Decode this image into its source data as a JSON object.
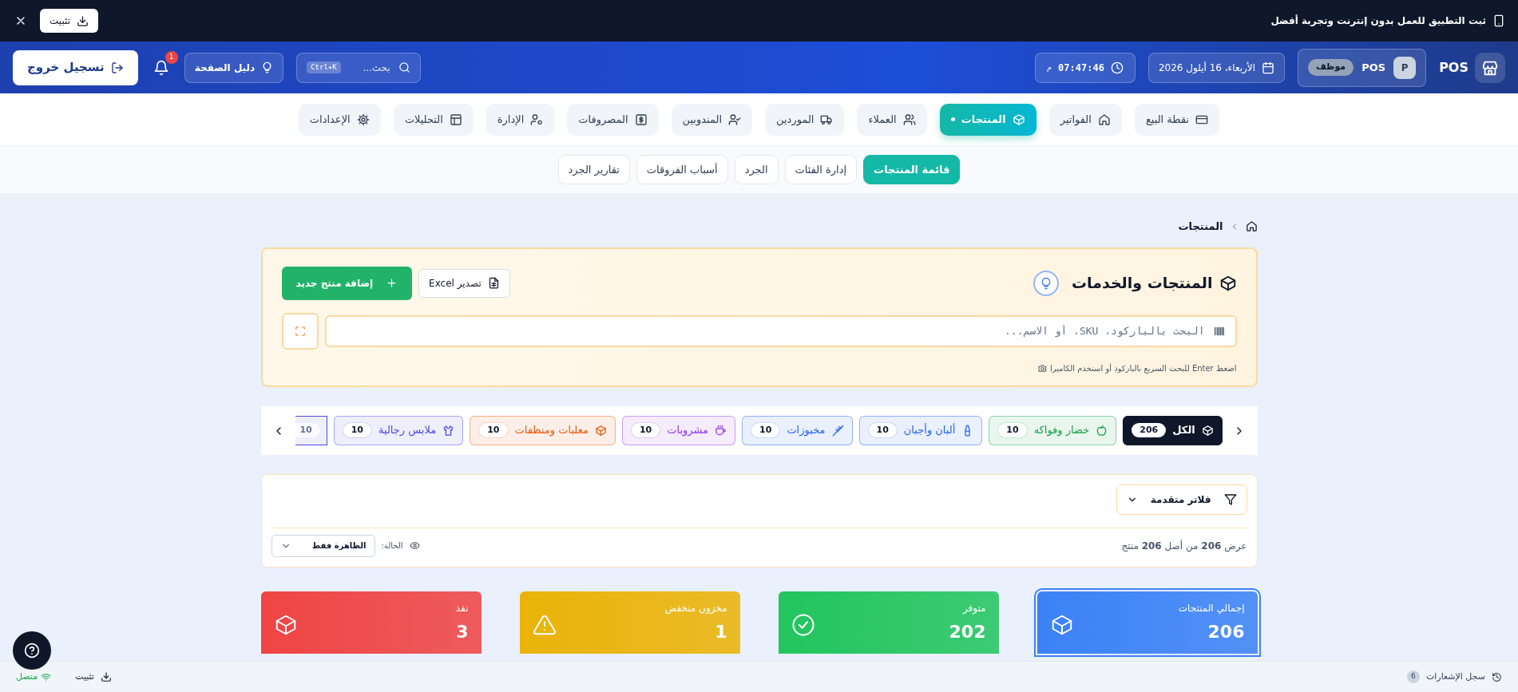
{
  "banner": {
    "text": "ثبت التطبيق للعمل بدون إنترنت وتجربة أفضل",
    "install_button": "تثبيت"
  },
  "header": {
    "brand": "POS",
    "user": {
      "avatar": "P",
      "name": "POS",
      "role": "موظف"
    },
    "date": "الأربعاء، 16 أيلول 2026",
    "time": "07:47:46",
    "time_suffix": "م",
    "search": {
      "placeholder": "بحث...",
      "shortcut": "Ctrl+K"
    },
    "guide_button": "دليل الصفحة",
    "notification_count": "1",
    "logout_button": "تسجيل خروج"
  },
  "main_nav": [
    {
      "label": "نقطة البيع",
      "selected": false
    },
    {
      "label": "الفواتير",
      "selected": false
    },
    {
      "label": "المنتجات",
      "selected": true
    },
    {
      "label": "العملاء",
      "selected": false
    },
    {
      "label": "الموردين",
      "selected": false
    },
    {
      "label": "المندوبين",
      "selected": false
    },
    {
      "label": "المصروفات",
      "selected": false
    },
    {
      "label": "الإدارة",
      "selected": false
    },
    {
      "label": "التحليلات",
      "selected": false
    },
    {
      "label": "الإعدادات",
      "selected": false
    }
  ],
  "sub_nav": [
    {
      "label": "قائمة المنتجات",
      "selected": true
    },
    {
      "label": "إدارة الفئات",
      "selected": false
    },
    {
      "label": "الجرد",
      "selected": false
    },
    {
      "label": "أسباب الفروقات",
      "selected": false
    },
    {
      "label": "تقارير الجرد",
      "selected": false
    }
  ],
  "breadcrumb": [
    "المنتجات"
  ],
  "products_panel": {
    "title": "المنتجات والخدمات",
    "export_button": "تصدير Excel",
    "add_button": "إضافة منتج جديد",
    "search_placeholder": "البحث بالباركود، SKU، أو الاسم...",
    "hint": "اضغط Enter للبحث السريع بالباركود أو استخدم الكاميرا"
  },
  "categories": [
    {
      "label": "الكل",
      "count": "206",
      "selected": true,
      "color": "#0f172a"
    },
    {
      "label": "خضار وفواكه",
      "count": "10",
      "selected": false,
      "color": "#16a34a"
    },
    {
      "label": "ألبان وأجبان",
      "count": "10",
      "selected": false,
      "color": "#2563eb"
    },
    {
      "label": "مخبوزات",
      "count": "10",
      "selected": false,
      "color": "#2563eb"
    },
    {
      "label": "مشروبات",
      "count": "10",
      "selected": false,
      "color": "#9333ea"
    },
    {
      "label": "معلبات ومنظفات",
      "count": "10",
      "selected": false,
      "color": "#ea580c"
    },
    {
      "label": "ملابس رجالية",
      "count": "10",
      "selected": false,
      "color": "#4f46e5"
    },
    {
      "count": "10",
      "selected": false,
      "color": "#4f46e5"
    }
  ],
  "filters": {
    "button": "فلاتر متقدمة",
    "summary": "عرض **206** من أصل **206** منتج",
    "status_label": "الحالة:",
    "status_value": "الظاهرة فقط"
  },
  "stats": [
    {
      "label": "إجمالي المنتجات",
      "value": "206",
      "color": "#3b82f6",
      "selected": true
    },
    {
      "label": "متوفر",
      "value": "202",
      "color": "#22c55e",
      "selected": false
    },
    {
      "label": "مخزون منخفض",
      "value": "1",
      "color": "#eab308",
      "selected": false
    },
    {
      "label": "نفذ",
      "value": "3",
      "color": "#ef4444",
      "selected": false
    }
  ],
  "status_bar": {
    "notifications_log": "سجل الإشعارات",
    "notifications_count": "6",
    "install": "تثبيت",
    "connection": "متصل"
  }
}
